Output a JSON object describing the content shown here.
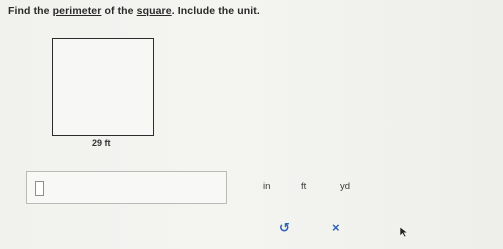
{
  "question": {
    "text_before_perimeter": "Find the ",
    "perimeter_link": "perimeter",
    "text_of_the": " of the ",
    "square_link": "square",
    "text_after": ". Include the unit."
  },
  "figure": {
    "side_label": "29 ft"
  },
  "answer": {
    "value": ""
  },
  "units": {
    "in_label": "in",
    "ft_label": "ft",
    "yd_label": "yd"
  },
  "actions": {
    "undo_glyph": "↺",
    "clear_glyph": "×"
  }
}
